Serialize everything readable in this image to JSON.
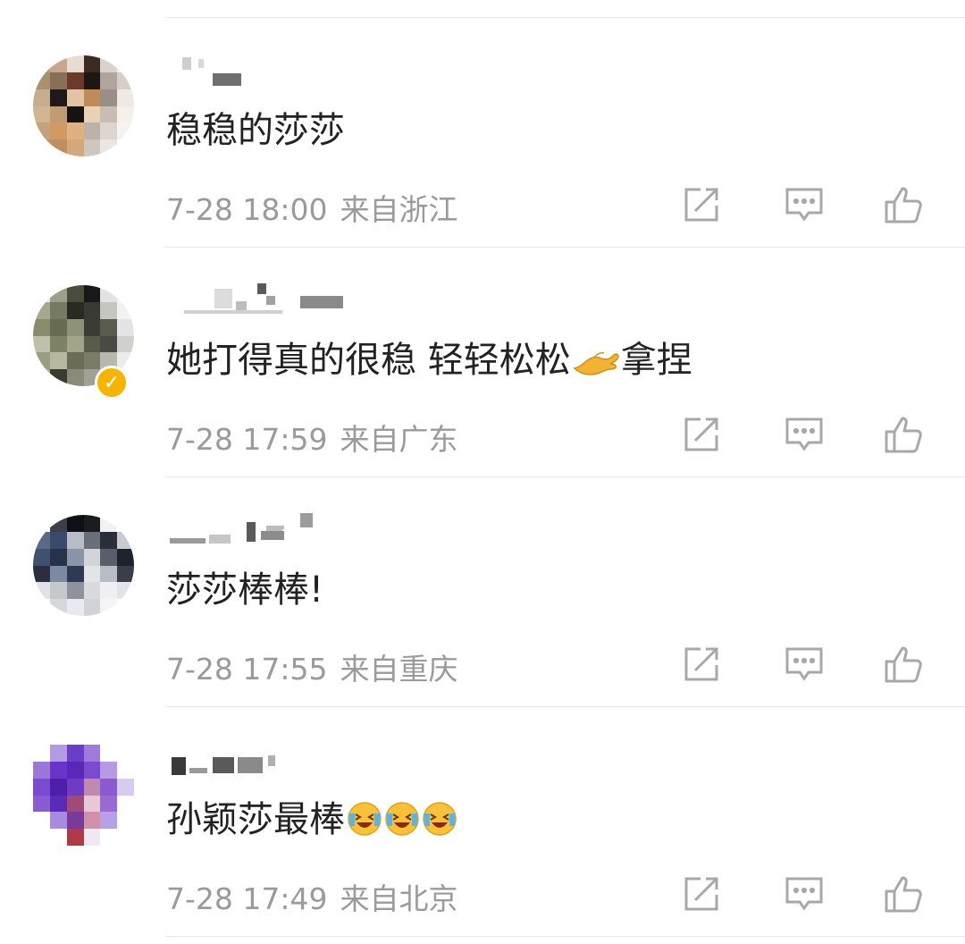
{
  "comments": [
    {
      "text": "稳稳的莎莎",
      "time": "7-28 18:00",
      "location": "来自浙江",
      "verified": false
    },
    {
      "text": "她打得真的很稳  轻轻松松",
      "text_after": "拿捏",
      "emoji": "pinching-hand",
      "time": "7-28 17:59",
      "location": "来自广东",
      "verified": true
    },
    {
      "text": "莎莎棒棒!",
      "time": "7-28 17:55",
      "location": "来自重庆",
      "verified": false
    },
    {
      "text": "孙颖莎最棒",
      "emoji": "crying-laughing-face x3",
      "time": "7-28 17:49",
      "location": "来自北京",
      "verified": false
    }
  ],
  "actions": [
    "share-icon",
    "comment-icon",
    "like-icon"
  ],
  "colors": {
    "text": "#222222",
    "meta": "#9a9a9a",
    "icon": "#a8a8a8",
    "verified": "#f5b400"
  }
}
